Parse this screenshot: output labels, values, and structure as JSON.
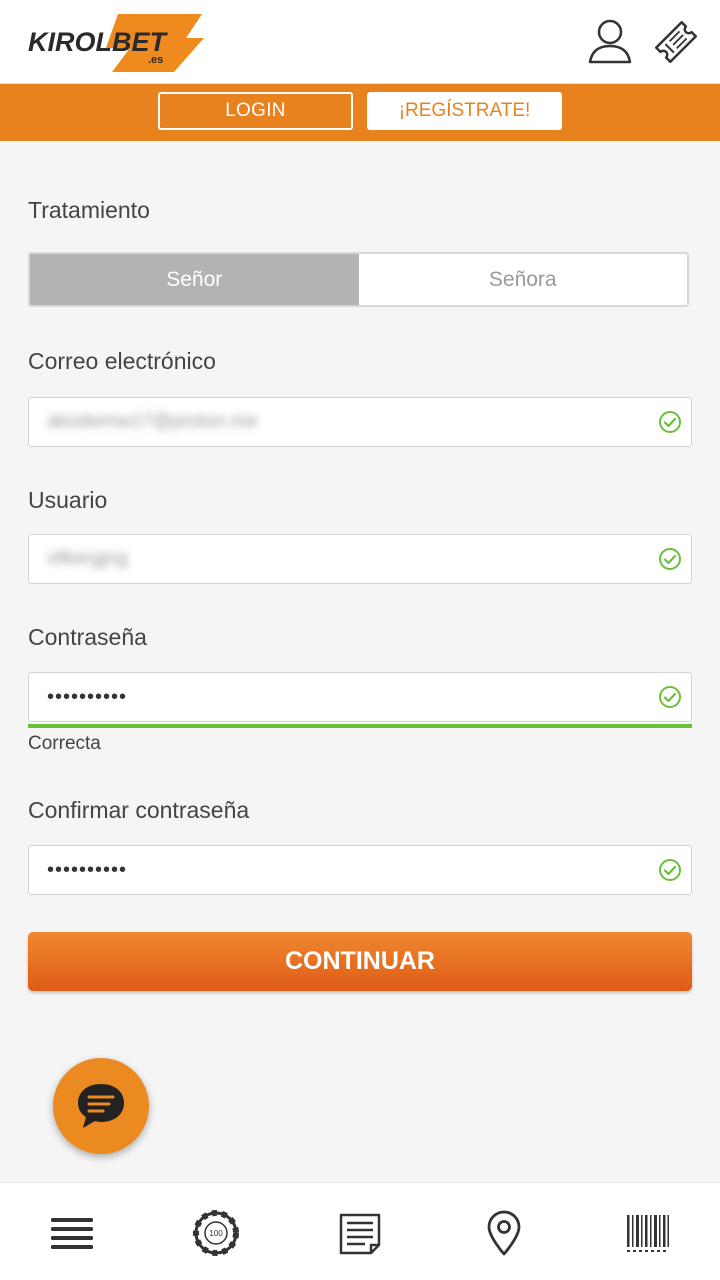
{
  "header": {
    "logo_text": "KIROLBET",
    "logo_suffix": ".es",
    "icons": [
      "user-icon",
      "ticket-icon"
    ]
  },
  "auth": {
    "login_label": "LOGIN",
    "register_label": "¡REGÍSTRATE!"
  },
  "form": {
    "treatment": {
      "label": "Tratamiento",
      "options": [
        "Señor",
        "Señora"
      ],
      "selected": "Señor"
    },
    "email": {
      "label": "Correo electrónico",
      "value": "aksdwrnw17@proton.me",
      "valid": true
    },
    "username": {
      "label": "Usuario",
      "value": "vllkergjng",
      "valid": true
    },
    "password": {
      "label": "Contraseña",
      "value": "••••••••••",
      "valid": true,
      "strength_text": "Correcta",
      "strength": 1.0
    },
    "confirm_password": {
      "label": "Confirmar contraseña",
      "value": "••••••••••",
      "valid": true
    },
    "submit_label": "CONTINUAR"
  },
  "chat": {
    "icon": "chat-icon"
  },
  "bottom_nav": {
    "items": [
      "menu-icon",
      "casino-chip-icon",
      "news-icon",
      "location-pin-icon",
      "barcode-icon"
    ]
  },
  "colors": {
    "brand_orange": "#e8821e",
    "button_gradient_top": "#f08830",
    "button_gradient_bottom": "#de5c16",
    "valid_green": "#6cbf3a",
    "selected_grey": "#b3b3b3"
  }
}
